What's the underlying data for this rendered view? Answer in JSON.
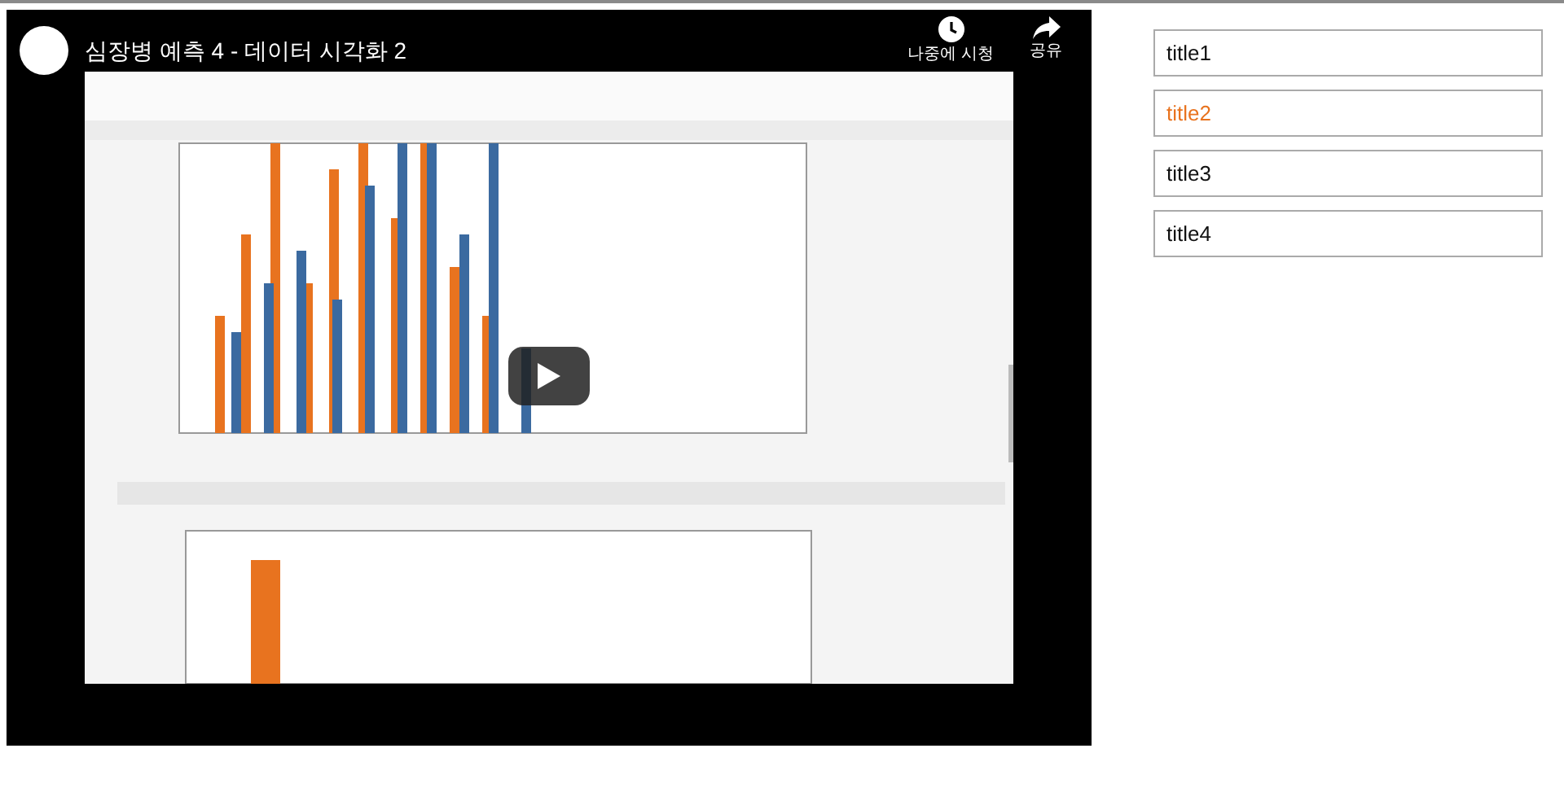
{
  "video": {
    "title": "심장병 예측 4 - 데이터 시각화 2",
    "actions": [
      {
        "kind": "watch_later",
        "label": "나중에 시청"
      },
      {
        "kind": "share",
        "label": "공유"
      }
    ]
  },
  "playlist": [
    {
      "label": "title1",
      "selected": false
    },
    {
      "label": "title2",
      "selected": true
    },
    {
      "label": "title3",
      "selected": false
    },
    {
      "label": "title4",
      "selected": false
    }
  ]
}
